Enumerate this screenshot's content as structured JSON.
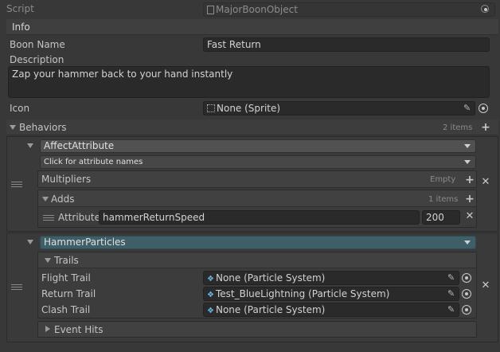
{
  "script": {
    "label": "Script",
    "value": "MajorBoonObject"
  },
  "info": {
    "header": "Info"
  },
  "boon_name": {
    "label": "Boon Name",
    "value": "Fast Return"
  },
  "description": {
    "label": "Description",
    "value": "Zap your hammer back to your hand instantly"
  },
  "icon": {
    "label": "Icon",
    "value": "None (Sprite)"
  },
  "behaviors": {
    "label": "Behaviors",
    "count": "2 items",
    "affect_attribute": {
      "type": "AffectAttribute",
      "attribute_names_placeholder": "Click for attribute names",
      "multipliers": {
        "label": "Multipliers",
        "status": "Empty"
      },
      "adds": {
        "label": "Adds",
        "count": "1 items",
        "row": {
          "label": "Attribute",
          "name": "hammerReturnSpeed",
          "value": "200"
        }
      }
    },
    "hammer_particles": {
      "type": "HammerParticles",
      "trails": {
        "label": "Trails",
        "flight": {
          "label": "Flight Trail",
          "value": "None (Particle System)"
        },
        "return": {
          "label": "Return Trail",
          "value": "Test_BlueLightning (Particle System)"
        },
        "clash": {
          "label": "Clash Trail",
          "value": "None (Particle System)"
        }
      },
      "event_hits": {
        "label": "Event Hits"
      }
    }
  },
  "colors": {
    "background": "#383838",
    "field": "#2a2a2a",
    "selected_dropdown": "#3e5f67",
    "particle_icon": "#6cb6e0"
  }
}
